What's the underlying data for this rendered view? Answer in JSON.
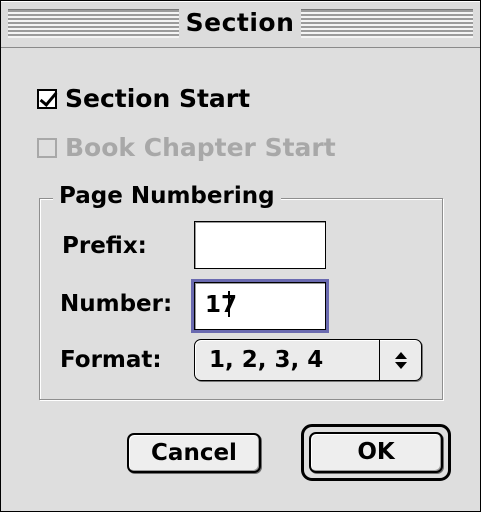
{
  "window": {
    "title": "Section"
  },
  "options": {
    "section_start_label": "Section Start",
    "section_start_checked": true,
    "book_chapter_start_label": "Book Chapter Start",
    "book_chapter_start_checked": false,
    "book_chapter_start_enabled": false
  },
  "page_numbering": {
    "group_label": "Page Numbering",
    "prefix_label": "Prefix:",
    "prefix_value": "",
    "number_label": "Number:",
    "number_value": "17",
    "format_label": "Format:",
    "format_value": "1, 2, 3, 4"
  },
  "buttons": {
    "cancel_label": "Cancel",
    "ok_label": "OK"
  },
  "colors": {
    "dialog_background": "#dedede",
    "focus_ring": "#6a6ab0",
    "disabled_text": "#a8a8a8"
  }
}
